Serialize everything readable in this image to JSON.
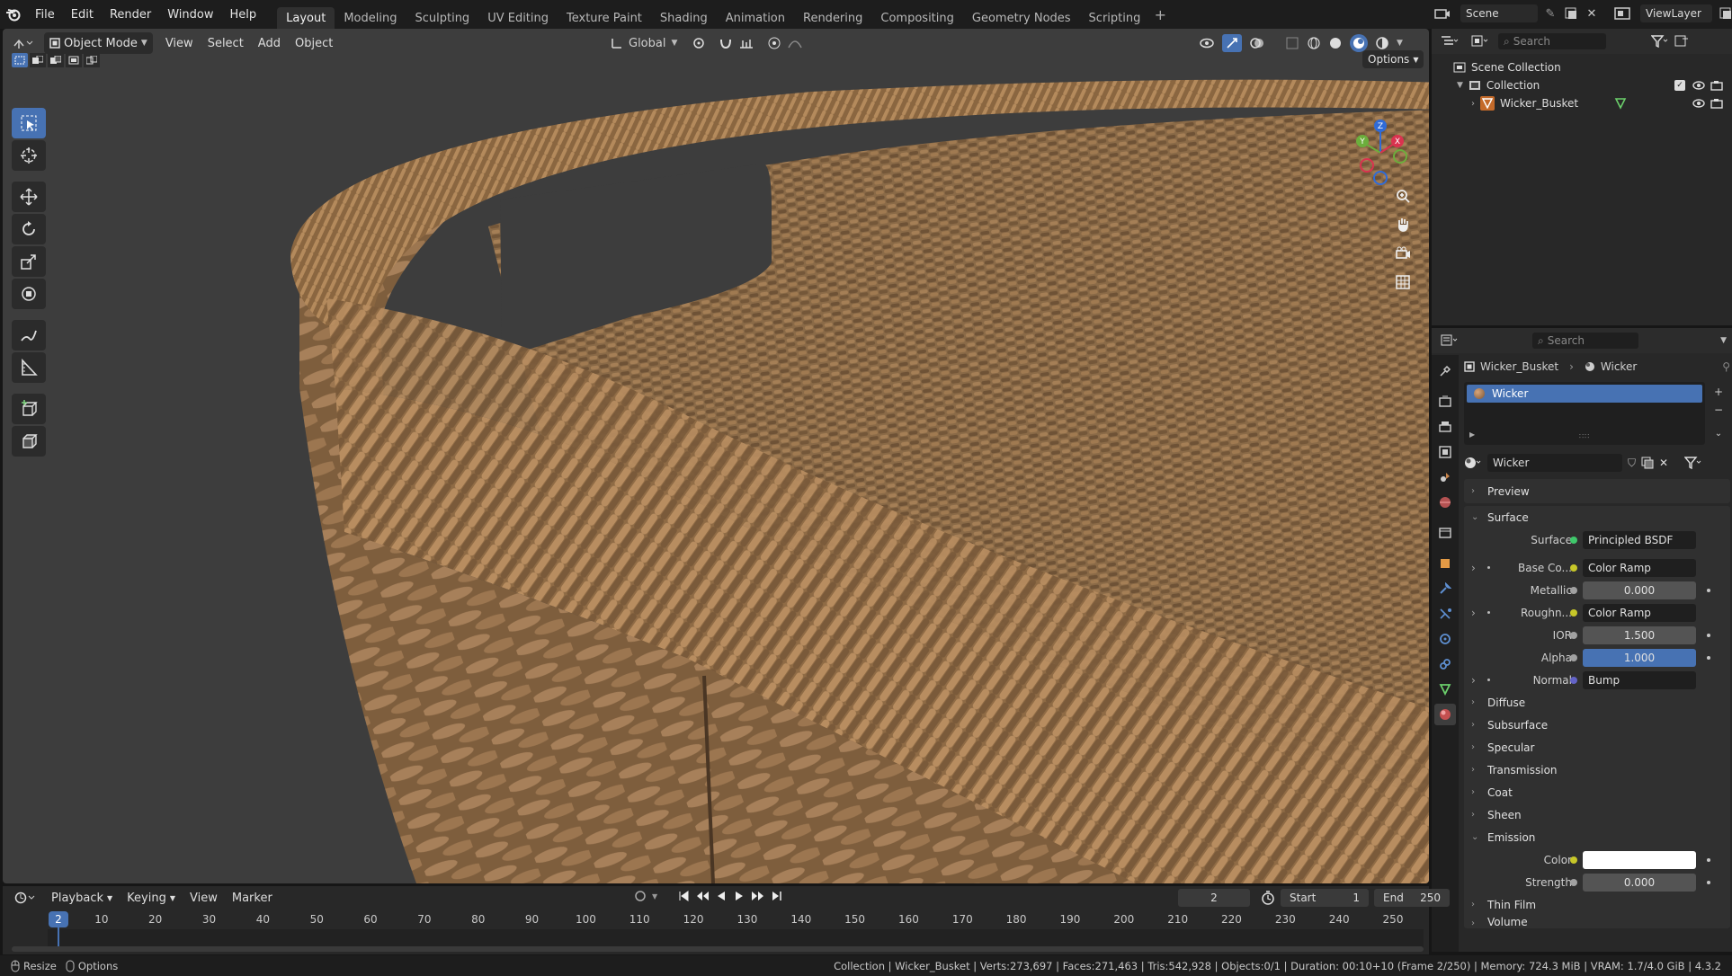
{
  "menu": [
    "File",
    "Edit",
    "Render",
    "Window",
    "Help"
  ],
  "workspaces": [
    "Layout",
    "Modeling",
    "Sculpting",
    "UV Editing",
    "Texture Paint",
    "Shading",
    "Animation",
    "Rendering",
    "Compositing",
    "Geometry Nodes",
    "Scripting"
  ],
  "active_workspace": "Layout",
  "scene": {
    "label": "Scene",
    "viewlayer": "ViewLayer"
  },
  "viewport": {
    "mode": "Object Mode",
    "menus": [
      "View",
      "Select",
      "Add",
      "Object"
    ],
    "orientation": "Global",
    "options_label": "Options",
    "gizmo": {
      "x": "X",
      "y": "Y",
      "z": "Z"
    }
  },
  "outliner": {
    "search_placeholder": "Search",
    "scene_collection": "Scene Collection",
    "collection": "Collection",
    "object": "Wicker_Busket"
  },
  "properties": {
    "search_placeholder": "Search",
    "breadcrumb_object": "Wicker_Busket",
    "breadcrumb_material": "Wicker",
    "slot": "Wicker",
    "material_name": "Wicker",
    "sections": {
      "preview": "Preview",
      "surface": "Surface"
    },
    "surface_label": "Surface",
    "surface_value": "Principled BSDF",
    "rows": [
      {
        "label": "Base Co...",
        "value": "Color Ramp",
        "type": "link",
        "sock": "#c7c729",
        "expander": true
      },
      {
        "label": "Metallic",
        "value": "0.000",
        "type": "num",
        "sock": "#a1a1a1"
      },
      {
        "label": "Roughn...",
        "value": "Color Ramp",
        "type": "link",
        "sock": "#c7c729",
        "expander": true
      },
      {
        "label": "IOR",
        "value": "1.500",
        "type": "num",
        "sock": "#a1a1a1"
      },
      {
        "label": "Alpha",
        "value": "1.000",
        "type": "blue",
        "sock": "#a1a1a1"
      },
      {
        "label": "Normal",
        "value": "Bump",
        "type": "link",
        "sock": "#6363c7",
        "expander": true
      }
    ],
    "subsections": [
      "Diffuse",
      "Subsurface",
      "Specular",
      "Transmission",
      "Coat",
      "Sheen"
    ],
    "emission": {
      "title": "Emission",
      "color_label": "Color",
      "strength_label": "Strength",
      "strength_value": "0.000"
    },
    "thin_film": "Thin Film",
    "volume": "Volume",
    "colors": {
      "accent": "#4772b3",
      "emission_color": "#ffffff"
    }
  },
  "timeline": {
    "menus": [
      "Playback",
      "Keying",
      "View",
      "Marker"
    ],
    "current_frame": "2",
    "start_label": "Start",
    "start_value": "1",
    "end_label": "End",
    "end_value": "250",
    "ticks": [
      "10",
      "20",
      "30",
      "40",
      "50",
      "60",
      "70",
      "80",
      "90",
      "100",
      "110",
      "120",
      "130",
      "140",
      "150",
      "160",
      "170",
      "180",
      "190",
      "200",
      "210",
      "220",
      "230",
      "240",
      "250"
    ]
  },
  "status": {
    "left": [
      "Resize",
      "Options"
    ],
    "right": "Collection | Wicker_Busket | Verts:273,697 | Faces:271,463 | Tris:542,928 | Objects:0/1 | Duration: 00:10+10 (Frame 2/250) | Memory: 724.3 MiB | VRAM: 1.7/4.0 GiB | 4.3.2"
  }
}
